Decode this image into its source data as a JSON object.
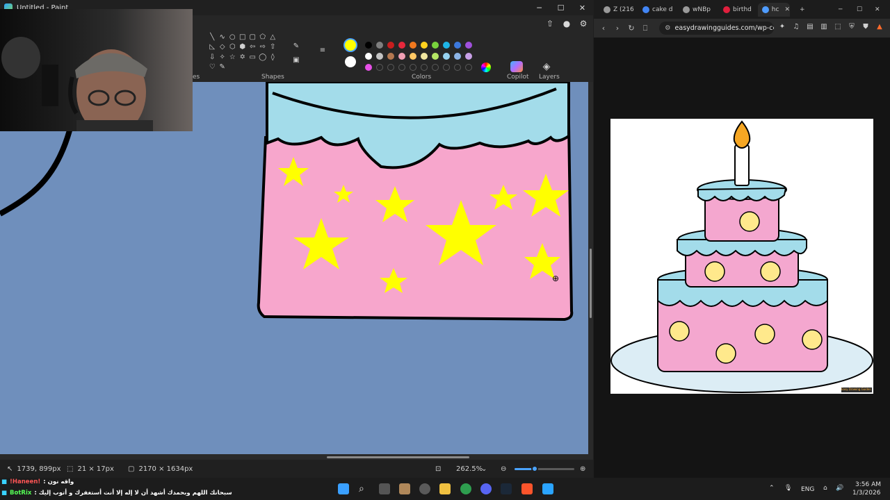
{
  "paint": {
    "title": "Untitled - Paint",
    "window_controls": {
      "minimize": "─",
      "maximize": "☐",
      "close": "✕"
    },
    "ribbon": {
      "group_labels": {
        "shapes": "Shapes",
        "colors": "Colors",
        "copilot": "Copilot",
        "layers": "Layers"
      },
      "partial_label": "es",
      "shapes": [
        "╲",
        "∿",
        "○",
        "□",
        "▢",
        "⬠",
        "△",
        "◺",
        "◇",
        "⬡",
        "⬢",
        "⇦",
        "⇨",
        "⇧",
        "⇩",
        "✧",
        "☆",
        "✡",
        "▭",
        "◯",
        "◊",
        "♡",
        "✎"
      ],
      "current_colors": {
        "primary": "#ffff00",
        "secondary": "#ffffff"
      },
      "swatches": [
        "#000000",
        "#7f7f7f",
        "#c81e1e",
        "#e6283c",
        "#f0781e",
        "#ffd21e",
        "#78d23c",
        "#1eb4e6",
        "#3c78dc",
        "#a050dc",
        "#ffffff",
        "#c3c3c3",
        "#b47850",
        "#f0a0b4",
        "#ffc864",
        "#f0e6a0",
        "#b4e664",
        "#96d2f0",
        "#8cb4e6",
        "#c8a0e6",
        "#e650e6",
        "",
        "",
        "",
        "",
        "",
        "",
        "",
        "",
        ""
      ]
    },
    "status": {
      "cursor_position": "1739, 899px",
      "selection_size": "21 × 17px",
      "canvas_size": "2170 × 1634px",
      "zoom": "262.5%",
      "zoom_level": 0.34
    }
  },
  "browser": {
    "tabs": [
      {
        "label": "Z (216",
        "color": "#9a9a9a"
      },
      {
        "label": "cake d",
        "color": "#4285f4"
      },
      {
        "label": "wNBp",
        "color": "#9a9a9a"
      },
      {
        "label": "birthd",
        "color": "#e01f3d"
      },
      {
        "label": "hc",
        "color": "#4f9cff"
      }
    ],
    "url": "easydrawingguides.com/wp-conte",
    "image_watermark": "Easy Drawing Guides"
  },
  "chat": [
    {
      "user": "!Haneen!",
      "user_color": "#ff5555",
      "message": ": واقه نون"
    },
    {
      "user": "BotRix",
      "user_color": "#55ff55",
      "message": ": سبحانك اللهم وبحمدك أشهد أن لا إله إلا أنت أستغفرك و أتوب إليك"
    }
  ],
  "taskbar": {
    "language": "ENG",
    "time": "3:56 AM",
    "date": "1/3/2026"
  }
}
